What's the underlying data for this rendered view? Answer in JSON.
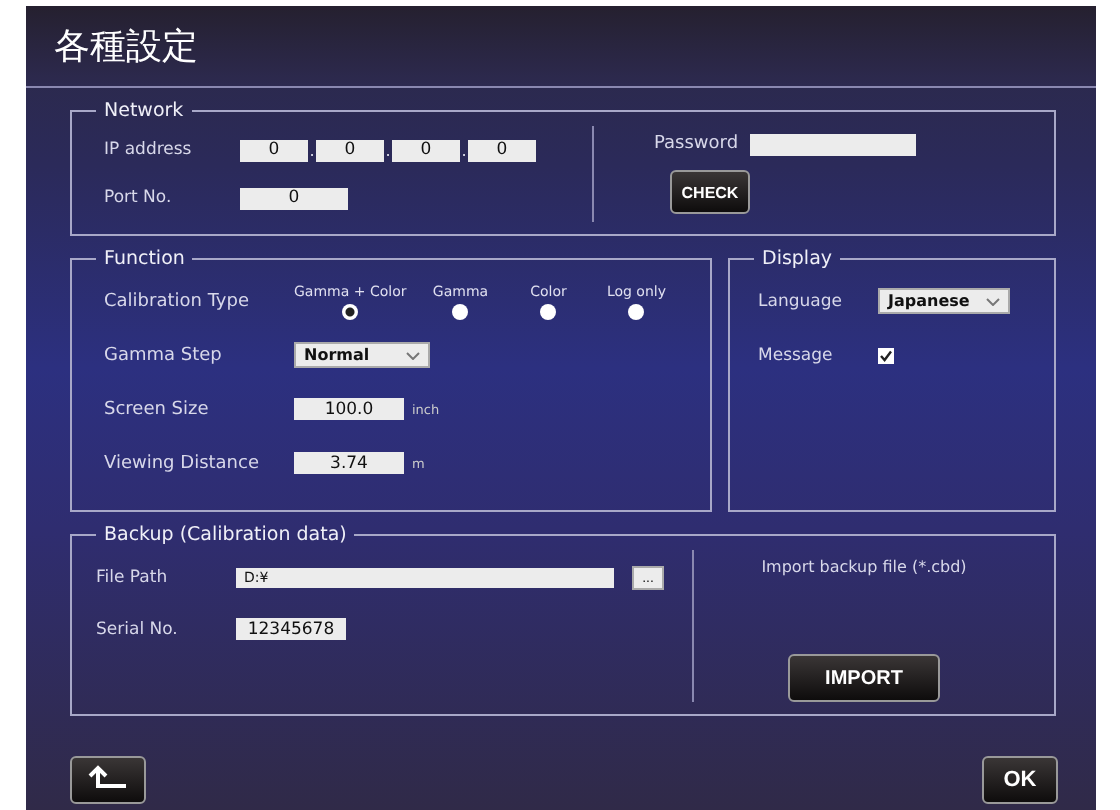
{
  "window": {
    "title": "各種設定"
  },
  "network": {
    "legend": "Network",
    "ip_label": "IP address",
    "ip": [
      "0",
      "0",
      "0",
      "0"
    ],
    "ip_separator": ".",
    "port_label": "Port No.",
    "port": "0",
    "password_label": "Password",
    "check_button": "CHECK"
  },
  "function": {
    "legend": "Function",
    "calibration_label": "Calibration Type",
    "calibration_options": [
      {
        "label": "Gamma + Color",
        "selected": true
      },
      {
        "label": "Gamma",
        "selected": false
      },
      {
        "label": "Color",
        "selected": false
      },
      {
        "label": "Log only",
        "selected": false
      }
    ],
    "gamma_step_label": "Gamma Step",
    "gamma_step": "Normal",
    "screen_size_label": "Screen Size",
    "screen_size": "100.0",
    "screen_size_unit": "inch",
    "distance_label": "Viewing Distance",
    "distance": "3.74",
    "distance_unit": "m"
  },
  "display": {
    "legend": "Display",
    "language_label": "Language",
    "language": "Japanese",
    "message_label": "Message",
    "message_checked": true
  },
  "backup": {
    "legend": "Backup (Calibration data)",
    "file_path_label": "File Path",
    "file_path": "D:¥",
    "browse_button": "...",
    "serial_label": "Serial No.",
    "serial": "12345678",
    "import_hint": "Import backup file (*.cbd)",
    "import_button": "IMPORT"
  },
  "footer": {
    "ok_button": "OK"
  }
}
